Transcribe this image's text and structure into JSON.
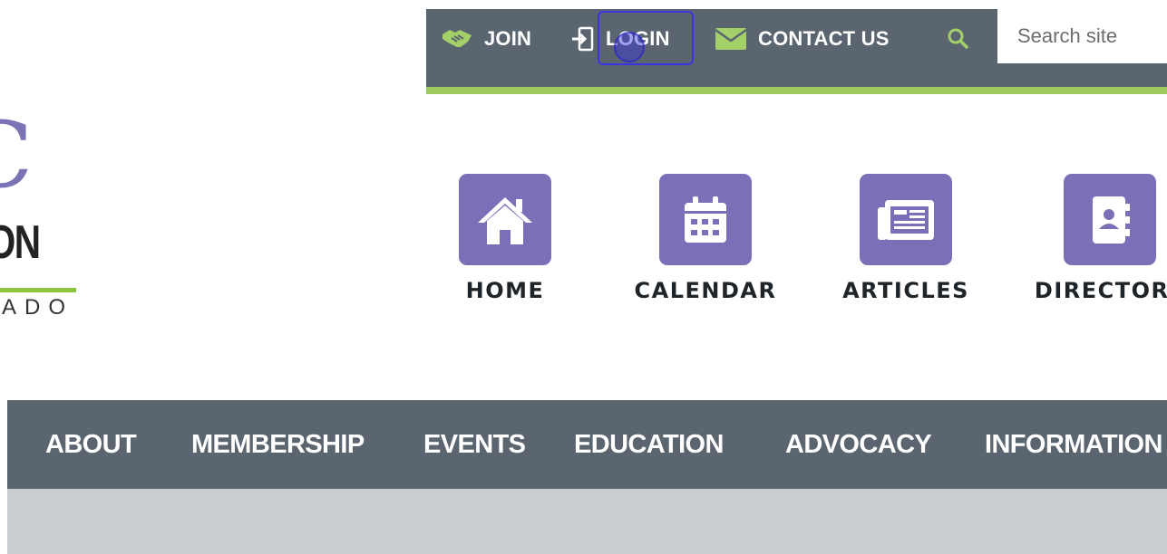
{
  "topbar": {
    "join_label": "JOIN",
    "login_label": "LOGIN",
    "contact_label": "CONTACT US",
    "search_placeholder": "Search site",
    "icons": [
      "handshake-icon",
      "sign-in-icon",
      "envelope-icon",
      "search-icon"
    ]
  },
  "logo": {
    "letter": "C",
    "word": "ION",
    "sub": "ADO"
  },
  "icon_nav": [
    {
      "label": "HOME",
      "icon": "house-icon"
    },
    {
      "label": "CALENDAR",
      "icon": "calendar-icon"
    },
    {
      "label": "ARTICLES",
      "icon": "newspaper-icon"
    },
    {
      "label": "DIRECTORY",
      "icon": "address-book-icon"
    }
  ],
  "main_nav": [
    "ABOUT",
    "MEMBERSHIP",
    "EVENTS",
    "EDUCATION",
    "ADVOCACY",
    "INFORMATION"
  ],
  "colors": {
    "bar": "#5a6570",
    "accent_green": "#9ccb5c",
    "tile_purple": "#7970b8",
    "icon_green": "#a3d069",
    "hero_gray": "#c9ccd0"
  }
}
